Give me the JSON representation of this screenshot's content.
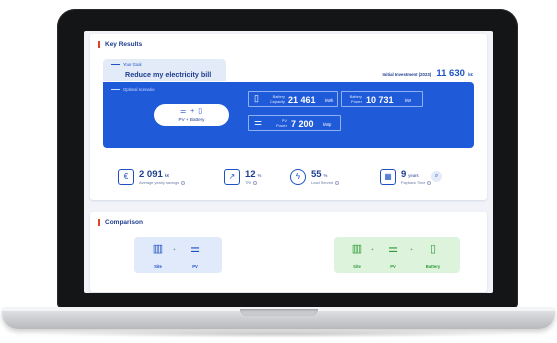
{
  "key_results": {
    "title": "Key Results",
    "goal_label": "Your Goal",
    "goal_value": "Reduce my electricity bill",
    "initial_investment_label": "Initial Investment (2023)",
    "initial_investment_value": "11 630",
    "initial_investment_unit": "k€",
    "optimal_label": "Optimal scenario",
    "scenario_text": "PV + Battery",
    "battery_capacity_label_1": "Battery",
    "battery_capacity_label_2": "Capacity",
    "battery_capacity_value": "21 461",
    "battery_capacity_unit": "kWh",
    "battery_power_label_1": "Battery",
    "battery_power_label_2": "Power",
    "battery_power_value": "10 731",
    "battery_power_unit": "kW",
    "pv_power_label_1": "PV",
    "pv_power_label_2": "Power",
    "pv_power_value": "7 200",
    "pv_power_unit": "kWp"
  },
  "metrics": [
    {
      "value": "2 091",
      "unit": "k€",
      "label": "Average yearly savings",
      "icon": "savings-icon"
    },
    {
      "value": "12",
      "unit": "%",
      "label": "TRI",
      "icon": "chart-growth-icon"
    },
    {
      "value": "55",
      "unit": "%",
      "label": "Load Served",
      "icon": "lightning-icon"
    },
    {
      "value": "9",
      "unit": "years",
      "label": "Payback Time",
      "icon": "calendar-icon"
    }
  ],
  "comparison": {
    "title": "Comparison",
    "left": {
      "site": "Site",
      "pv": "PV"
    },
    "right": {
      "site": "Site",
      "pv": "PV",
      "battery": "Battery"
    }
  },
  "colors": {
    "accent": "#1f5ad8",
    "navy": "#1d3d8f",
    "marker": "#e0452c",
    "green": "#2f9a3a"
  }
}
